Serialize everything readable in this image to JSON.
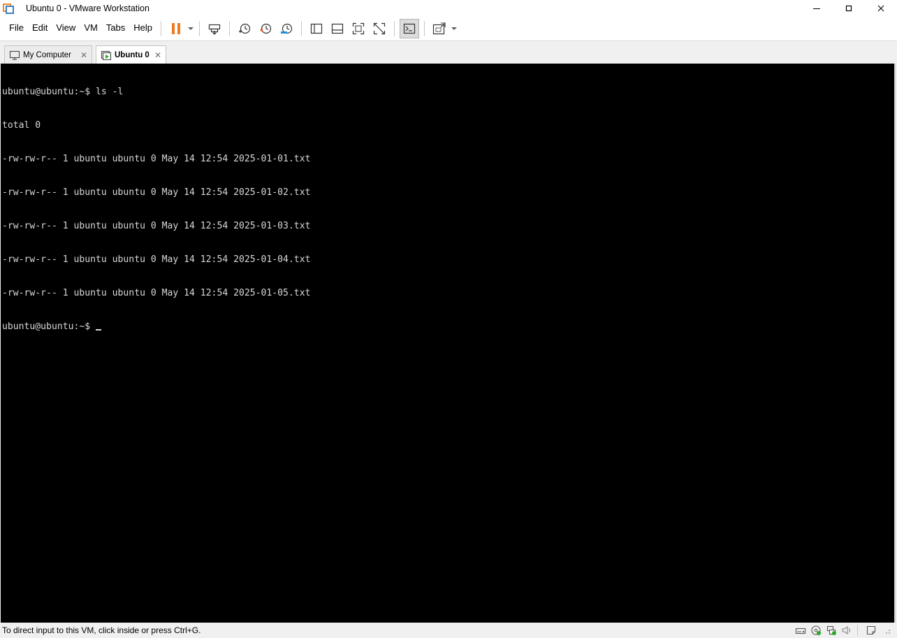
{
  "window": {
    "title": "Ubuntu 0 - VMware Workstation",
    "minimize_glyph": "—",
    "maximize_glyph": "☐",
    "close_glyph": "✕"
  },
  "menu": {
    "items": [
      "File",
      "Edit",
      "View",
      "VM",
      "Tabs",
      "Help"
    ]
  },
  "toolbar": {
    "buttons": [
      {
        "icon": "pause-icon",
        "color": "#f07a22"
      },
      {
        "icon": "send-ctrl-alt-del-icon"
      },
      {
        "icon": "snapshot-icon"
      },
      {
        "icon": "revert-snapshot-icon",
        "color": "#e0501e"
      },
      {
        "icon": "snapshot-manager-icon",
        "color": "#1e8fd0"
      },
      {
        "icon": "library-view-icon"
      },
      {
        "icon": "thumbnail-bar-icon"
      },
      {
        "icon": "full-screen-icon"
      },
      {
        "icon": "unity-icon"
      },
      {
        "icon": "console-view-icon"
      },
      {
        "icon": "stretch-guest-icon"
      }
    ]
  },
  "tabs": [
    {
      "label": "My Computer",
      "icon": "monitor-icon",
      "close": "✕",
      "active": false
    },
    {
      "label": "Ubuntu 0",
      "icon": "vm-running-icon",
      "close": "✕",
      "active": true
    }
  ],
  "console": {
    "lines": [
      "ubuntu@ubuntu:~$ ls -l",
      "total 0",
      "-rw-rw-r-- 1 ubuntu ubuntu 0 May 14 12:54 2025-01-01.txt",
      "-rw-rw-r-- 1 ubuntu ubuntu 0 May 14 12:54 2025-01-02.txt",
      "-rw-rw-r-- 1 ubuntu ubuntu 0 May 14 12:54 2025-01-03.txt",
      "-rw-rw-r-- 1 ubuntu ubuntu 0 May 14 12:54 2025-01-04.txt",
      "-rw-rw-r-- 1 ubuntu ubuntu 0 May 14 12:54 2025-01-05.txt"
    ],
    "prompt": "ubuntu@ubuntu:~$ ",
    "background": "#000000",
    "foreground": "#d8d8d8"
  },
  "statusbar": {
    "message": "To direct input to this VM, click inside or press Ctrl+G.",
    "icons": [
      "hard-disk-icon",
      "cd-dvd-icon",
      "network-adapter-icon",
      "sound-icon",
      "message-log-icon"
    ]
  }
}
